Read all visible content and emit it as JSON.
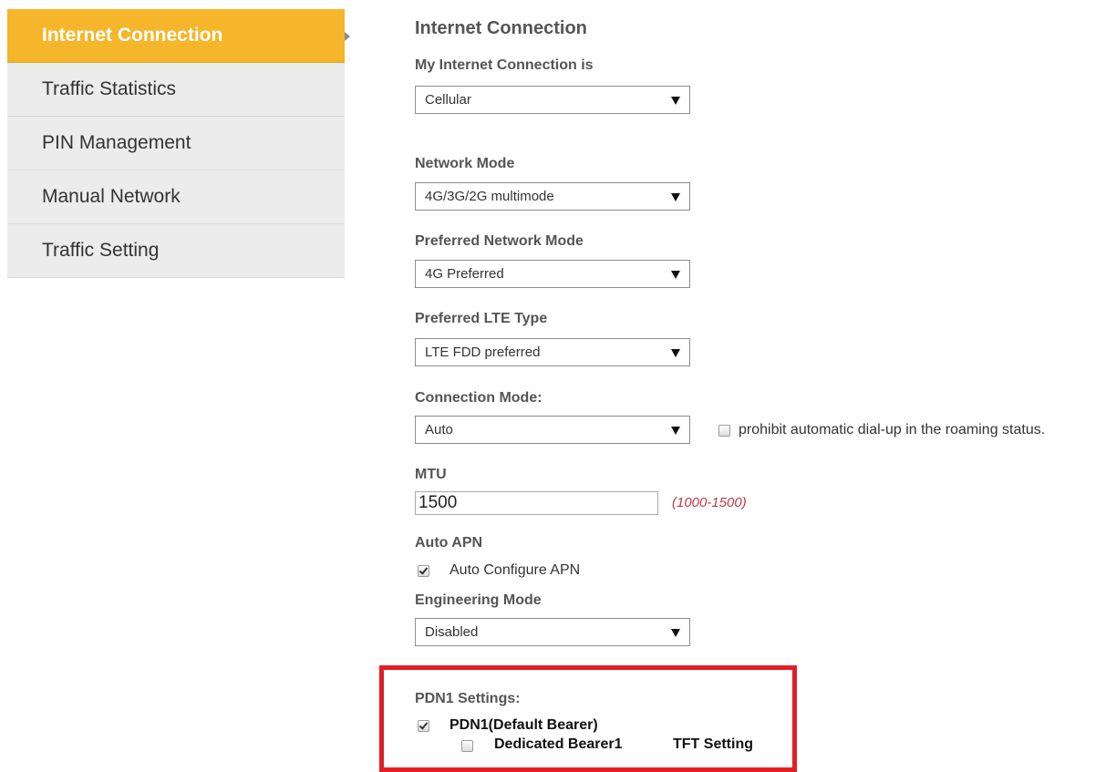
{
  "sidebar": {
    "items": [
      {
        "label": "Internet Connection",
        "active": true
      },
      {
        "label": "Traffic Statistics",
        "active": false
      },
      {
        "label": "PIN Management",
        "active": false
      },
      {
        "label": "Manual Network",
        "active": false
      },
      {
        "label": "Traffic Setting",
        "active": false
      }
    ]
  },
  "form": {
    "title": "Internet Connection",
    "connection_type": {
      "label": "My Internet Connection is",
      "value": "Cellular"
    },
    "network_mode": {
      "label": "Network Mode",
      "value": "4G/3G/2G multimode"
    },
    "preferred_network_mode": {
      "label": "Preferred Network Mode",
      "value": "4G Preferred"
    },
    "preferred_lte_type": {
      "label": "Preferred LTE Type",
      "value": "LTE FDD preferred"
    },
    "connection_mode": {
      "label": "Connection Mode:",
      "value": "Auto",
      "roaming_checkbox_label": "prohibit automatic dial-up in the roaming status.",
      "roaming_checked": false
    },
    "mtu": {
      "label": "MTU",
      "value": "1500",
      "hint": "(1000-1500)"
    },
    "auto_apn": {
      "label": "Auto APN",
      "checkbox_label": "Auto Configure APN",
      "checked": true
    },
    "engineering_mode": {
      "label": "Engineering Mode",
      "value": "Disabled"
    },
    "pdn1": {
      "label": "PDN1 Settings:",
      "default_bearer_label": "PDN1(Default Bearer)",
      "default_bearer_checked": true,
      "dedicated_bearer_label": "Dedicated Bearer1",
      "dedicated_bearer_checked": false,
      "tft_label": "TFT Setting"
    }
  },
  "colors": {
    "active_tab": "#f5b62b",
    "sidebar_bg": "#ececec",
    "highlight_border": "#e31e25",
    "hint_text": "#c0394b"
  }
}
